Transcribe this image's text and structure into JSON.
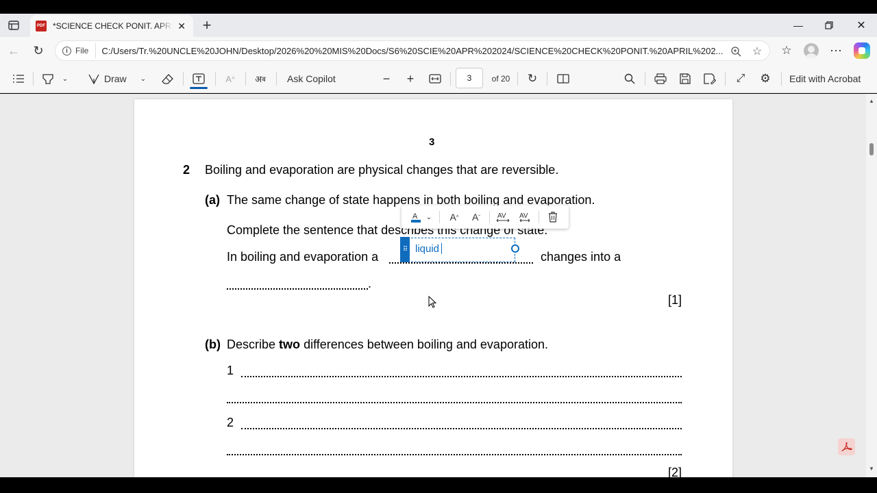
{
  "browser": {
    "tab_title": "*SCIENCE CHECK PONIT. APRIL 2024.pdf",
    "address_scheme": "File",
    "address_url": "C:/Users/Tr.%20UNCLE%20JOHN/Desktop/2026%20%20MIS%20Docs/S6%20SCIE%20APR%202024/SCIENCE%20CHECK%20PONIT.%20APRIL%202..."
  },
  "pdf_toolbar": {
    "draw_label": "Draw",
    "ask_copilot_label": "Ask Copilot",
    "page_current": "3",
    "page_total": "of 20",
    "edit_acrobat_label": "Edit with Acrobat"
  },
  "document": {
    "page_number": "3",
    "q_num": "2",
    "q_stem": "Boiling and evaporation are physical changes that are reversible.",
    "a_label": "(a)",
    "a_text": "The same change of state happens in both boiling and evaporation.",
    "a_instruction": "Complete the sentence that describes this change of state.",
    "a_sentence_start": "In boiling and evaporation a",
    "a_sentence_mid": "changes into a",
    "a_sentence_end": ".",
    "a_marks": "[1]",
    "b_label": "(b)",
    "b_text_before": "Describe",
    "b_text_bold": "two",
    "b_text_after": "differences between boiling and evaporation.",
    "b_item1": "1",
    "b_item2": "2",
    "b_marks": "[2]"
  },
  "annotation": {
    "text_value": "liquid",
    "toolbar_icons": [
      "text-color-icon",
      "increase-font-size-icon",
      "decrease-font-size-icon",
      "increase-spacing-icon",
      "decrease-spacing-icon",
      "delete-icon"
    ]
  },
  "colors": {
    "accent": "#0f6cbd",
    "pdf_favicon": "#c5251f"
  }
}
